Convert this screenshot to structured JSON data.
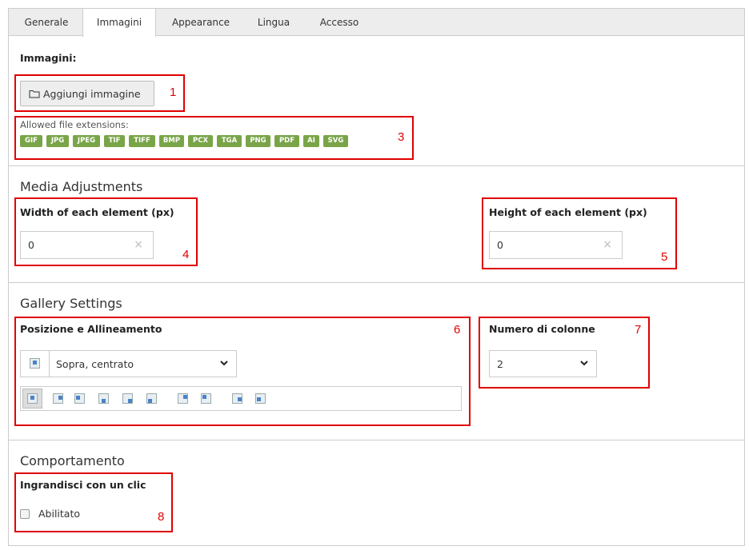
{
  "tabs": [
    {
      "label": "Generale"
    },
    {
      "label": "Immagini"
    },
    {
      "label": "Appearance"
    },
    {
      "label": "Lingua"
    },
    {
      "label": "Accesso"
    }
  ],
  "images": {
    "label": "Immagini:",
    "add_button": "Aggiungi immagine",
    "allowed_label": "Allowed file extensions:",
    "extensions": [
      "GIF",
      "JPG",
      "JPEG",
      "TIF",
      "TIFF",
      "BMP",
      "PCX",
      "TGA",
      "PNG",
      "PDF",
      "AI",
      "SVG"
    ]
  },
  "media": {
    "title": "Media Adjustments",
    "width_label": "Width of each element (px)",
    "width_value": "0",
    "height_label": "Height of each element (px)",
    "height_value": "0",
    "clear_glyph": "×"
  },
  "gallery": {
    "title": "Gallery Settings",
    "position_label": "Posizione e Allineamento",
    "position_value": "Sopra, centrato",
    "columns_label": "Numero di colonne",
    "columns_value": "2"
  },
  "behavior": {
    "title": "Comportamento",
    "zoom_label": "Ingrandisci con un clic",
    "enabled_label": "Abilitato",
    "enabled_checked": false
  },
  "annotations": [
    "1",
    "3",
    "4",
    "5",
    "6",
    "7",
    "8"
  ],
  "colors": {
    "badge": "#79a548",
    "annotation": "#e00000"
  }
}
